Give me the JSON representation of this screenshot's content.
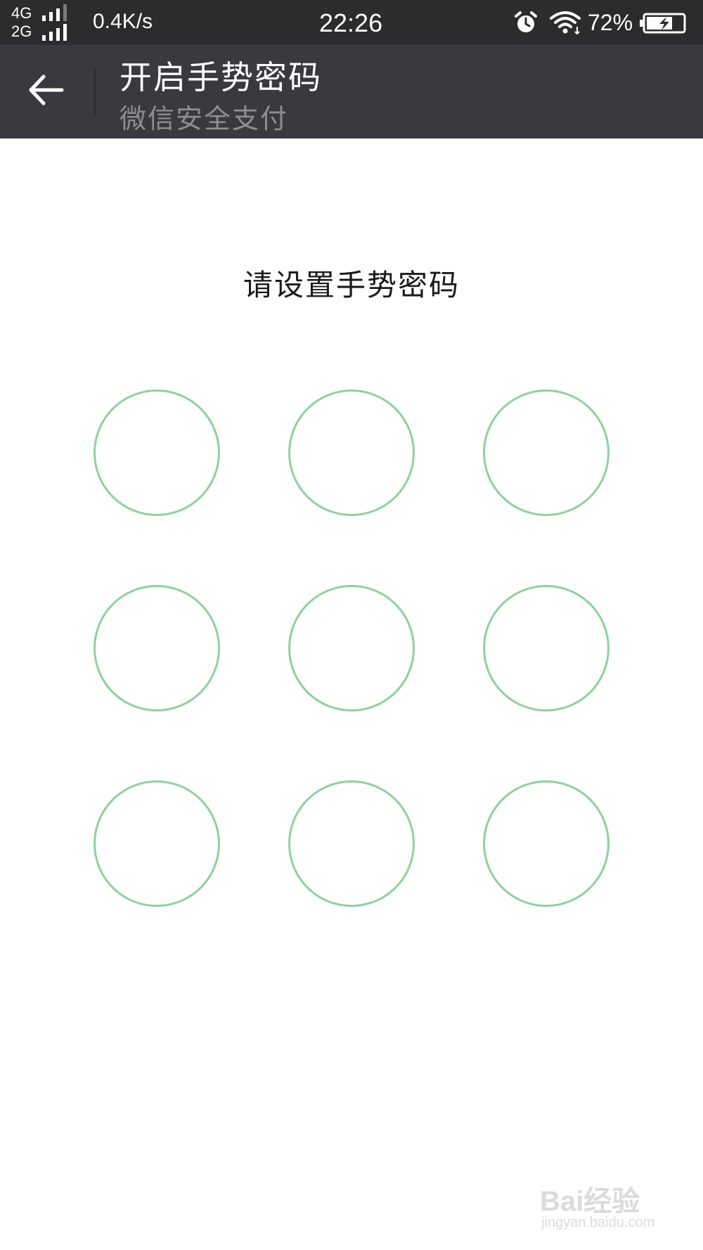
{
  "status_bar": {
    "network_types": [
      "4G",
      "2G"
    ],
    "signal_levels": [
      3,
      4
    ],
    "net_speed": "0.4K/s",
    "time": "22:26",
    "battery_percent": "72%",
    "battery_level": 0.72,
    "charging": true,
    "icons": [
      "alarm-icon",
      "wifi-icon",
      "battery-charging-icon"
    ]
  },
  "title_bar": {
    "title": "开启手势密码",
    "subtitle": "微信安全支付",
    "back_icon": "arrow-left-icon"
  },
  "main": {
    "prompt": "请设置手势密码",
    "gesture_dots": [
      {
        "row": 1,
        "col": 1
      },
      {
        "row": 1,
        "col": 2
      },
      {
        "row": 1,
        "col": 3
      },
      {
        "row": 2,
        "col": 1
      },
      {
        "row": 2,
        "col": 2
      },
      {
        "row": 2,
        "col": 3
      },
      {
        "row": 3,
        "col": 1
      },
      {
        "row": 3,
        "col": 2
      },
      {
        "row": 3,
        "col": 3
      }
    ]
  },
  "watermark": {
    "brand": "Bai经验",
    "url": "jingyan.baidu.com"
  },
  "colors": {
    "status_bar_bg": "#2c2c2e",
    "title_bar_bg": "#393a3f",
    "subtitle_text": "#8d8d92",
    "gesture_ring": "#8fd19e",
    "page_bg": "#ffffff"
  }
}
